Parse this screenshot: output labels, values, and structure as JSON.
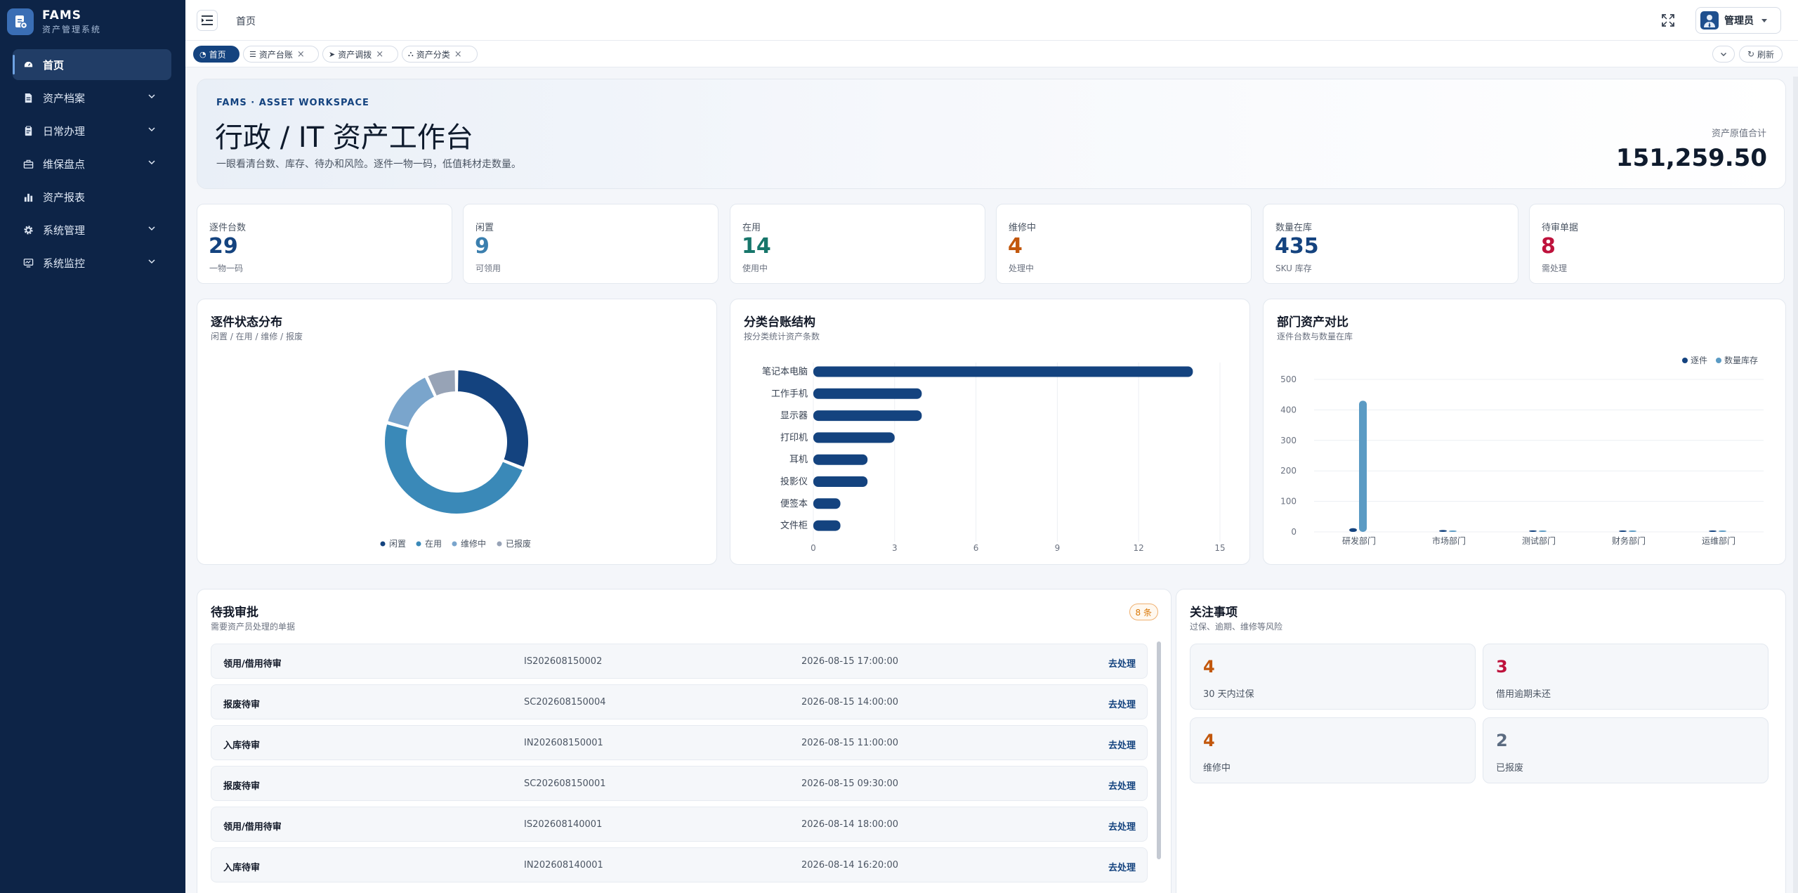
{
  "brand": {
    "title": "FAMS",
    "subtitle": "资产管理系统"
  },
  "menu": [
    {
      "label": "首页",
      "icon": "dashboard-icon",
      "active": true
    },
    {
      "label": "资产档案",
      "icon": "file-icon",
      "expandable": true
    },
    {
      "label": "日常办理",
      "icon": "clipboard-icon",
      "expandable": true
    },
    {
      "label": "维保盘点",
      "icon": "toolbox-icon",
      "expandable": true
    },
    {
      "label": "资产报表",
      "icon": "bar-chart-icon"
    },
    {
      "label": "系统管理",
      "icon": "gear-icon",
      "expandable": true
    },
    {
      "label": "系统监控",
      "icon": "monitor-icon",
      "expandable": true
    }
  ],
  "topbar": {
    "breadcrumb": "首页",
    "user": "管理员"
  },
  "tabs": [
    {
      "label": "首页",
      "icon": "dashboard-icon",
      "active": true
    },
    {
      "label": "资产台账",
      "icon": "list-icon",
      "closable": true
    },
    {
      "label": "资产调拨",
      "icon": "send-icon",
      "closable": true
    },
    {
      "label": "资产分类",
      "icon": "sitemap-icon",
      "closable": true
    }
  ],
  "tab_actions": {
    "refresh": "刷新"
  },
  "hero": {
    "eyebrow": "FAMS · ASSET WORKSPACE",
    "title": "行政 / IT 资产工作台",
    "desc": "一眼看清台数、库存、待办和风险。逐件一物一码，低值耗材走数量。",
    "total_label": "资产原值合计",
    "total_value": "151,259.50"
  },
  "stats": [
    {
      "label": "逐件台数",
      "value": "29",
      "sub": "一物一码",
      "color": "#14437f"
    },
    {
      "label": "闲置",
      "value": "9",
      "sub": "可领用",
      "color": "#3b7fae"
    },
    {
      "label": "在用",
      "value": "14",
      "sub": "使用中",
      "color": "#17766b"
    },
    {
      "label": "维修中",
      "value": "4",
      "sub": "处理中",
      "color": "#c2570c"
    },
    {
      "label": "数量在库",
      "value": "435",
      "sub": "SKU 库存",
      "color": "#14437f"
    },
    {
      "label": "待审单据",
      "value": "8",
      "sub": "需处理",
      "color": "#be123c"
    }
  ],
  "colors": {
    "idle": "#14437f",
    "inuse": "#3a89b8",
    "repair": "#7aa5cc",
    "scrapped": "#97a3b6",
    "bar": "#14437f",
    "bar2": "#5b9bc4"
  },
  "status_card": {
    "title": "逐件状态分布",
    "subtitle": "闲置 / 在用 / 维修 / 报废"
  },
  "category_card": {
    "title": "分类台账结构",
    "subtitle": "按分类统计资产条数"
  },
  "dept_card": {
    "title": "部门资产对比",
    "subtitle": "逐件台数与数量在库"
  },
  "chart_data": [
    {
      "type": "pie",
      "title": "逐件状态分布",
      "labels": [
        "闲置",
        "在用",
        "维修中",
        "已报废"
      ],
      "values": [
        9,
        14,
        4,
        2
      ]
    },
    {
      "type": "bar",
      "orientation": "horizontal",
      "title": "分类台账结构",
      "categories": [
        "笔记本电脑",
        "工作手机",
        "显示器",
        "打印机",
        "耳机",
        "投影仪",
        "便签本",
        "文件柜"
      ],
      "values": [
        14,
        4,
        4,
        3,
        2,
        2,
        1,
        1
      ],
      "xticks": [
        "0",
        "3",
        "6",
        "9",
        "12",
        "15"
      ],
      "xlim": [
        0,
        15
      ],
      "grid": true
    },
    {
      "type": "bar",
      "title": "部门资产对比",
      "categories": [
        "研发部门",
        "市场部门",
        "测试部门",
        "财务部门",
        "运维部门"
      ],
      "series": [
        {
          "name": "逐件",
          "values": [
            12,
            6,
            5,
            3,
            3
          ]
        },
        {
          "name": "数量库存",
          "values": [
            430,
            2,
            2,
            1,
            0
          ]
        }
      ],
      "yticks": [
        "0",
        "100",
        "200",
        "300",
        "400",
        "500"
      ],
      "ylim": [
        0,
        500
      ],
      "legend": "top-right",
      "grid": true
    }
  ],
  "approvals": {
    "title": "待我审批",
    "subtitle": "需要资产员处理的单据",
    "count": "8 条",
    "action": "去处理",
    "rows": [
      {
        "type": "领用/借用待审",
        "code": "IS202608150002",
        "time": "2026-08-15 17:00:00"
      },
      {
        "type": "报废待审",
        "code": "SC202608150004",
        "time": "2026-08-15 14:00:00"
      },
      {
        "type": "入库待审",
        "code": "IN202608150001",
        "time": "2026-08-15 11:00:00"
      },
      {
        "type": "报废待审",
        "code": "SC202608150001",
        "time": "2026-08-15 09:30:00"
      },
      {
        "type": "领用/借用待审",
        "code": "IS202608140001",
        "time": "2026-08-14 18:00:00"
      },
      {
        "type": "入库待审",
        "code": "IN202608140001",
        "time": "2026-08-14 16:20:00"
      }
    ]
  },
  "focus": {
    "title": "关注事项",
    "subtitle": "过保、逾期、维修等风险",
    "items": [
      {
        "value": "4",
        "label": "30 天内过保",
        "color": "#c2570c"
      },
      {
        "value": "3",
        "label": "借用逾期未还",
        "color": "#be123c"
      },
      {
        "value": "4",
        "label": "维修中",
        "color": "#c2570c"
      },
      {
        "value": "2",
        "label": "已报废",
        "color": "#5b6b80"
      }
    ]
  }
}
